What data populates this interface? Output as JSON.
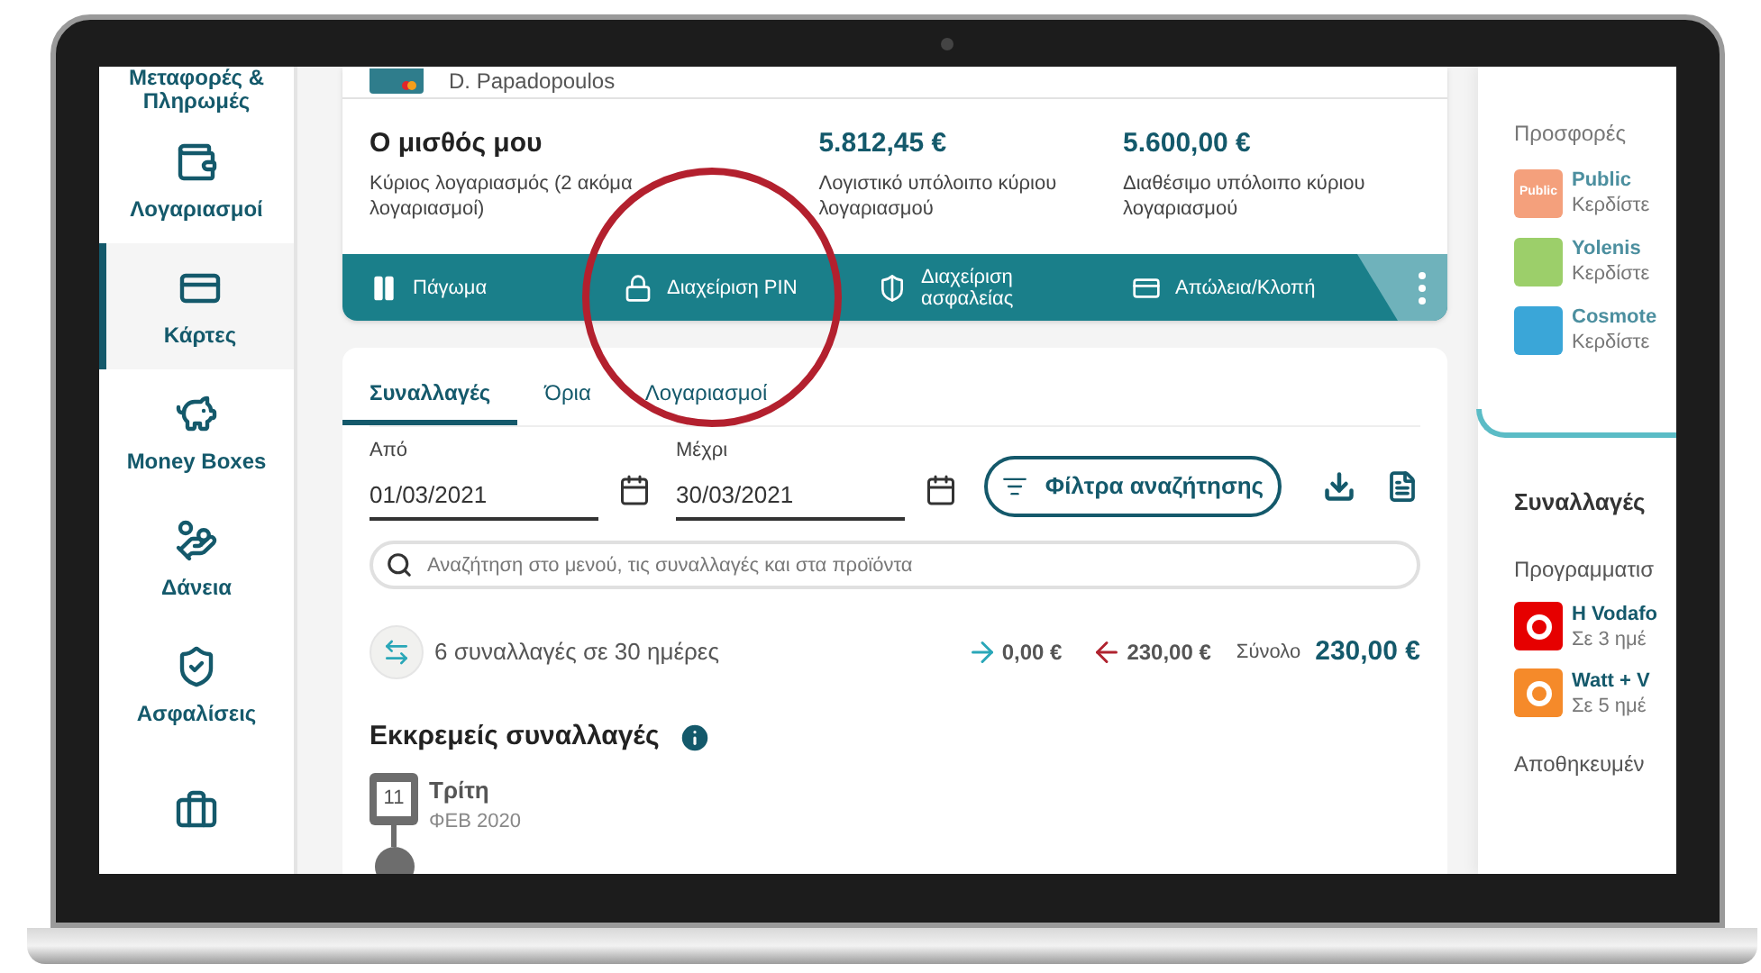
{
  "sidebar": {
    "items": [
      {
        "label": "Μεταφορές & Πληρωμές",
        "selected": false,
        "kind": "text"
      },
      {
        "label": "Λογαριασμοί",
        "selected": false,
        "kind": "wallet"
      },
      {
        "label": "Κάρτες",
        "selected": true,
        "kind": "cards"
      },
      {
        "label": "Money Boxes",
        "selected": false,
        "kind": "jar"
      },
      {
        "label": "Δάνεια",
        "selected": false,
        "kind": "loan"
      },
      {
        "label": "Ασφαλίσεις",
        "selected": false,
        "kind": "insurance"
      },
      {
        "selected": false,
        "kind": "invest"
      }
    ]
  },
  "card": {
    "holder": "D. Papadopoulos",
    "balances": [
      {
        "kind": "account",
        "title": "Ο μισθός μου",
        "subtitle": "Κύριος λογαριασμός (2 ακόμα λογαριασμοί)"
      },
      {
        "kind": "amount",
        "title": "5.812,45 €",
        "subtitle": "Λογιστικό υπόλοιπο κύριου λογαριασμού"
      },
      {
        "kind": "amount",
        "title": "5.600,00 €",
        "subtitle": "Διαθέσιμο υπόλοιπο κύριου λογαριασμού"
      }
    ],
    "actions": [
      {
        "label": "Πάγωμα",
        "kind": "pause"
      },
      {
        "label": "Διαχείριση PIN",
        "kind": "pin"
      },
      {
        "label": "Διαχείριση ασφαλείας",
        "kind": "security"
      },
      {
        "label": "Απώλεια/Κλοπή",
        "kind": "lost"
      }
    ]
  },
  "tabs": [
    {
      "label": "Συναλλαγές",
      "selected": true
    },
    {
      "label": "Όρια",
      "selected": false
    },
    {
      "label": "Λογαριασμοί",
      "selected": false
    }
  ],
  "date_fields": [
    {
      "label": "Από",
      "value": "01/03/2021"
    },
    {
      "label": "Μέχρι",
      "value": "30/03/2021"
    }
  ],
  "filter_button": "Φίλτρα αναζήτησης",
  "search": {
    "placeholder": "Αναζήτηση στο μενού, τις συναλλαγές και στα προϊόντα"
  },
  "summary": {
    "count": "6 συναλλαγές σε 30 ημέρες",
    "incoming": "0,00 €",
    "outgoing": "230,00 €",
    "total_label": "Σύνολο",
    "total": "230,00 €"
  },
  "pending": {
    "title": "Εκκρεμείς συναλλαγές",
    "day": "11",
    "weekday": "Τρίτη",
    "month": "ΦΕΒ 2020"
  },
  "right_panel": {
    "offers_title": "Προσφορές",
    "offers": [
      {
        "name": "Public",
        "subtitle": "Κερδίστε",
        "color": "#f4a07c",
        "logo_text": "Public"
      },
      {
        "name": "Yolenis",
        "subtitle": "Κερδίστε",
        "color": "#9ccf6a"
      },
      {
        "name": "Cosmote",
        "subtitle": "Κερδίστε",
        "color": "#3aa6d8"
      }
    ],
    "section_title": "Συναλλαγές",
    "scheduled_title": "Προγραμματισ",
    "scheduled": [
      {
        "name": "Η Vodafo",
        "subtitle": "Σε 3 ημέ",
        "color": "#e60000"
      },
      {
        "name": "Watt + V",
        "subtitle": "Σε 5 ημέ",
        "color": "#f58a2a"
      }
    ],
    "saved_title": "Αποθηκευμέν"
  }
}
